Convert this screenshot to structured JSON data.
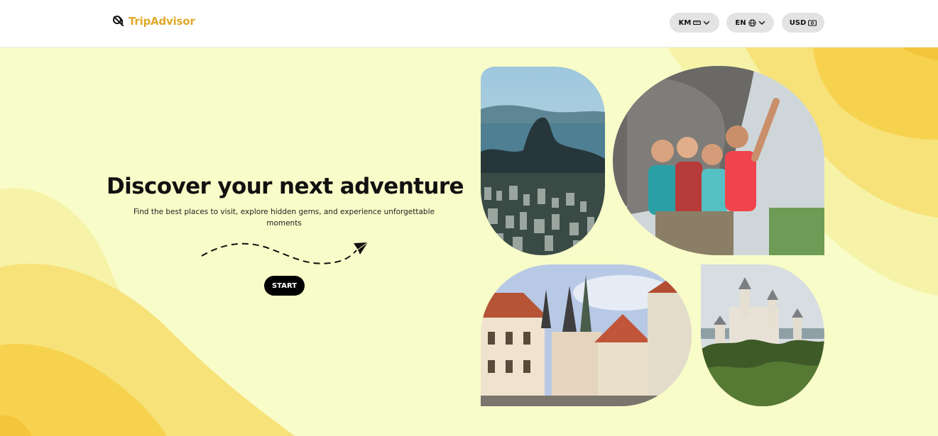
{
  "header": {
    "logo_text": "TripAdvisor",
    "units_label": "KM",
    "language_label": "EN",
    "currency_label": "USD"
  },
  "hero": {
    "title": "Discover your next adventure",
    "subtitle": "Find the best places to visit, explore hidden gems, and experience unforgettable moments",
    "start_label": "START"
  },
  "icons": {
    "logo": "tripadvisor-logo-icon",
    "units": "ruler-icon",
    "language": "globe-icon",
    "currency": "banknote-icon",
    "dropdown": "chevron-down-icon",
    "hero_path": "paper-plane-icon"
  },
  "colors": {
    "background": "#f8fcc8",
    "wave_light": "#f6f3a8",
    "wave_mid": "#f7e27a",
    "wave_dark": "#f6d24f",
    "brand": "#e0a92a",
    "button": "#000000"
  }
}
